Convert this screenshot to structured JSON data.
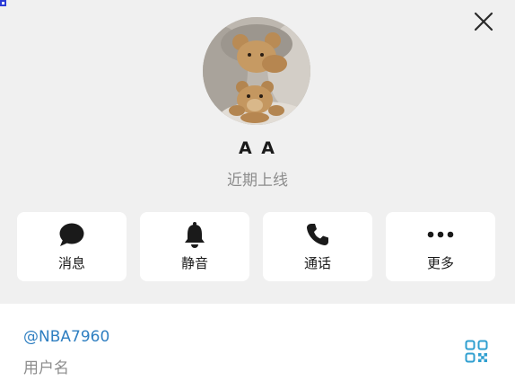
{
  "profile": {
    "name": "A A",
    "status": "近期上线"
  },
  "actions": [
    {
      "label": "消息",
      "icon": "message-bubble-icon"
    },
    {
      "label": "静音",
      "icon": "bell-icon"
    },
    {
      "label": "通话",
      "icon": "phone-icon"
    },
    {
      "label": "更多",
      "icon": "more-dots-icon"
    }
  ],
  "info": {
    "username": "@NBA7960",
    "username_label": "用户名"
  },
  "colors": {
    "background": "#f0f0f0",
    "card": "#ffffff",
    "link": "#2f7fc1",
    "muted": "#8c8c8c"
  }
}
